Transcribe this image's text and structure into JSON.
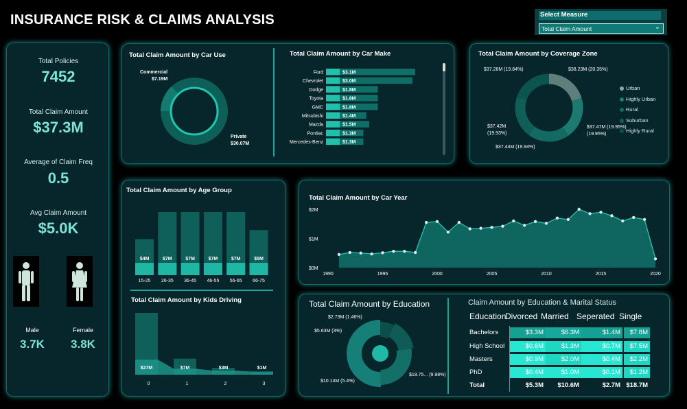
{
  "title": "INSURANCE RISK & CLAIMS ANALYSIS",
  "slicer": {
    "label": "Select Measure",
    "value": "Total Claim Amount"
  },
  "kpis": {
    "policies_label": "Total Policies",
    "policies_value": "7452",
    "claim_label": "Total Claim Amount",
    "claim_value": "$37.3M",
    "freq_label": "Average of Claim Freq",
    "freq_value": "0.5",
    "avg_label": "Avg Claim Amount",
    "avg_value": "$5.0K",
    "male_label": "Male",
    "male_value": "3.7K",
    "female_label": "Female",
    "female_value": "3.8K"
  },
  "car_use": {
    "title": "Total Claim Amount by Car Use",
    "commercial_label": "Commercial",
    "commercial_value": "$7.19M",
    "private_label": "Private",
    "private_value": "$30.07M"
  },
  "car_make": {
    "title": "Total Claim Amount by Car Make"
  },
  "coverage": {
    "title": "Total Claim Amount by Coverage Zone",
    "labels": [
      "$38.23M (20.35%)",
      "$37.47M (19.95%)",
      "$37.44M (19.94%)",
      "$37.42M",
      "(19.93%)",
      "$37.26M (19.84%)"
    ],
    "legend": [
      "Urban",
      "Highly Urban",
      "Rural",
      "Suburban",
      "Highly Rural"
    ]
  },
  "age": {
    "title": "Total Claim Amount by Age Group"
  },
  "kids": {
    "title": "Total Claim Amount by Kids Driving"
  },
  "car_year": {
    "title": "Total Claim Amount by Car Year"
  },
  "education": {
    "title": "Total Claim Amount by Education",
    "labels": [
      "$2.73M (1.46%)",
      "$5.63M (3%)",
      "$10.14M (5.4%)",
      "$18.75... (9.98%)"
    ]
  },
  "matrix": {
    "title": "Claim Amount by Education & Marital Status",
    "headers": [
      "Education",
      "Divorced",
      "Married",
      "Seperated",
      "Single"
    ],
    "rows": [
      {
        "name": "Bachelors",
        "values": [
          "$3.3M",
          "$6.3M",
          "$1.4M",
          "$7.8M"
        ]
      },
      {
        "name": "High School",
        "values": [
          "$0.6M",
          "$1.3M",
          "$0.7M",
          "$7.5M"
        ]
      },
      {
        "name": "Masters",
        "values": [
          "$0.9M",
          "$2.0M",
          "$0.4M",
          "$2.2M"
        ]
      },
      {
        "name": "PhD",
        "values": [
          "$0.4M",
          "$1.0M",
          "$0.1M",
          "$1.2M"
        ]
      }
    ],
    "total": {
      "name": "Total",
      "values": [
        "$5.3M",
        "$10.6M",
        "$2.7M",
        "$18.7M"
      ]
    }
  },
  "colors": {
    "bg": "#06262b",
    "accent": "#19b9a6",
    "bright": "#2ee6d2",
    "dark": "#0f5a57"
  },
  "chart_data": [
    {
      "type": "pie",
      "title": "Total Claim Amount by Car Use",
      "categories": [
        "Commercial",
        "Private"
      ],
      "values": [
        7.19,
        30.07
      ],
      "unit": "M"
    },
    {
      "type": "bar",
      "title": "Total Claim Amount by Car Make",
      "categories": [
        "Ford",
        "Chevrolet",
        "Dodge",
        "Toyota",
        "GMC",
        "Mitsubishi",
        "Mazda",
        "Pontiac",
        "Mercedes-Benz"
      ],
      "values": [
        3.1,
        3.0,
        1.8,
        1.8,
        1.8,
        1.4,
        1.5,
        1.3,
        1.3
      ],
      "labels": [
        "$3.1M",
        "$3.0M",
        "$1.8M",
        "$1.8M",
        "$1.8M",
        "$1.4M",
        "$1.5M",
        "$1.3M",
        "$1.3M"
      ]
    },
    {
      "type": "pie",
      "title": "Total Claim Amount by Coverage Zone",
      "categories": [
        "Urban",
        "Highly Urban",
        "Rural",
        "Suburban",
        "Highly Rural"
      ],
      "values": [
        38.23,
        37.47,
        37.44,
        37.42,
        37.26
      ]
    },
    {
      "type": "bar",
      "title": "Total Claim Amount by Age Group",
      "categories": [
        "15-25",
        "26-35",
        "36-45",
        "46-55",
        "56-65",
        "66-75"
      ],
      "values": [
        4,
        7,
        7,
        7,
        7,
        5
      ],
      "labels": [
        "$4M",
        "$7M",
        "$7M",
        "$7M",
        "$7M",
        "$5M"
      ]
    },
    {
      "type": "area",
      "title": "Total Claim Amount by Kids Driving",
      "categories": [
        "0",
        "1",
        "2",
        "3"
      ],
      "values": [
        27,
        7,
        3,
        1
      ],
      "labels": [
        "$27M",
        "$7M",
        "$3M",
        "$1M"
      ]
    },
    {
      "type": "area",
      "title": "Total Claim Amount by Car Year",
      "x": [
        1991,
        1992,
        1993,
        1994,
        1995,
        1996,
        1997,
        1998,
        1999,
        2000,
        2001,
        2002,
        2003,
        2004,
        2005,
        2006,
        2007,
        2008,
        2009,
        2010,
        2011,
        2012,
        2013,
        2014,
        2015,
        2016,
        2017,
        2018,
        2019,
        2020
      ],
      "y": [
        0.45,
        0.52,
        0.5,
        0.47,
        0.51,
        0.56,
        0.56,
        0.52,
        1.55,
        1.58,
        1.22,
        1.55,
        1.33,
        1.35,
        1.38,
        1.42,
        1.6,
        1.45,
        1.58,
        1.52,
        1.7,
        1.65,
        2.0,
        1.85,
        1.9,
        1.78,
        1.6,
        1.72,
        1.65,
        0.3
      ],
      "yticks": [
        "$0M",
        "$1M",
        "$2M"
      ],
      "xticks": [
        "1990",
        "1995",
        "2000",
        "2005",
        "2010",
        "2015",
        "2020"
      ],
      "ylim": [
        0,
        2
      ],
      "xlim": [
        1990,
        2020
      ]
    },
    {
      "type": "pie",
      "title": "Total Claim Amount by Education",
      "values": [
        2.73,
        5.63,
        10.14,
        18.75
      ]
    }
  ]
}
